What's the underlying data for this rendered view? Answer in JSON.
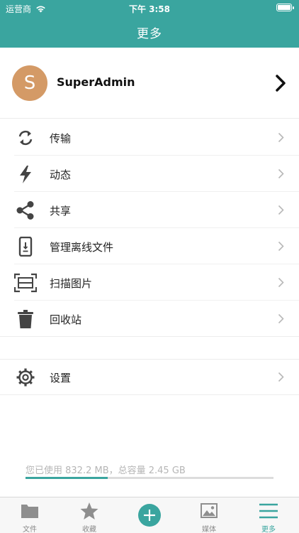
{
  "status_bar": {
    "carrier": "运营商",
    "time": "下午 3:58"
  },
  "header": {
    "title": "更多"
  },
  "profile": {
    "avatar_letter": "S",
    "name": "SuperAdmin"
  },
  "menu": [
    {
      "label": "传输",
      "icon": "sync-icon"
    },
    {
      "label": "动态",
      "icon": "lightning-icon"
    },
    {
      "label": "共享",
      "icon": "share-icon"
    },
    {
      "label": "管理离线文件",
      "icon": "offline-phone-icon"
    },
    {
      "label": "扫描图片",
      "icon": "scan-icon"
    },
    {
      "label": "回收站",
      "icon": "trash-icon"
    }
  ],
  "settings": {
    "label": "设置",
    "icon": "gear-icon"
  },
  "storage": {
    "text": "您已使用 832.2 MB，总容量 2.45 GB",
    "used_fraction": 0.33
  },
  "tabs": [
    {
      "label": "文件",
      "icon": "folder-icon"
    },
    {
      "label": "收藏",
      "icon": "star-icon"
    },
    {
      "label": "",
      "icon": "add-icon"
    },
    {
      "label": "媒体",
      "icon": "image-icon"
    },
    {
      "label": "更多",
      "icon": "menu-icon"
    }
  ],
  "colors": {
    "accent": "#3aa59f",
    "avatar": "#d49a66"
  }
}
